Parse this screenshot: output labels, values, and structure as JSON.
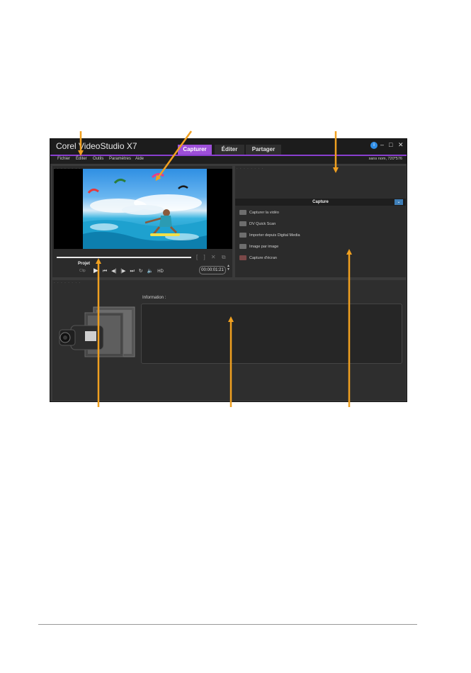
{
  "window": {
    "title": "Corel VideoStudio X7",
    "tabs": [
      {
        "label": "Capturer",
        "active": true
      },
      {
        "label": "Éditer",
        "active": false
      },
      {
        "label": "Partager",
        "active": false
      }
    ],
    "controls": {
      "info": "i",
      "minimize": "–",
      "maximize": "□",
      "close": "✕"
    },
    "accent_color": "#9d4fd8"
  },
  "menu": {
    "items": [
      "Fichier",
      "Éditer",
      "Outils",
      "Paramètres",
      "Aide"
    ],
    "project_info": "sans nom, 720*576"
  },
  "preview": {
    "grip": "· · · · · · · ·",
    "mark_tools": "[ ] ✕ ⧉",
    "project_label": "Projet",
    "clip_label": "Clip",
    "controls": {
      "play": "▶",
      "home": "⏮",
      "prev": "◀|",
      "next": "|▶",
      "end": "⏭",
      "repeat": "↻",
      "volume": "🔈",
      "hd": "HD"
    },
    "timecode": "00:00:01:21",
    "spinner_up": "▲",
    "spinner_down": "▼"
  },
  "capture": {
    "grip": "· · · · · · · ·",
    "header": "Capture",
    "dropdown": "⌄",
    "items": [
      {
        "label": "Capturer la vidéo",
        "icon": "camera-icon"
      },
      {
        "label": "DV Quick Scan",
        "icon": "scan-icon"
      },
      {
        "label": "Importer depuis Digital Media",
        "icon": "import-icon"
      },
      {
        "label": "Image par image",
        "icon": "frame-icon"
      },
      {
        "label": "Capture d'écran",
        "icon": "screen-icon"
      }
    ]
  },
  "information": {
    "grip": "· · · · · · · ·",
    "label": "Information :"
  }
}
